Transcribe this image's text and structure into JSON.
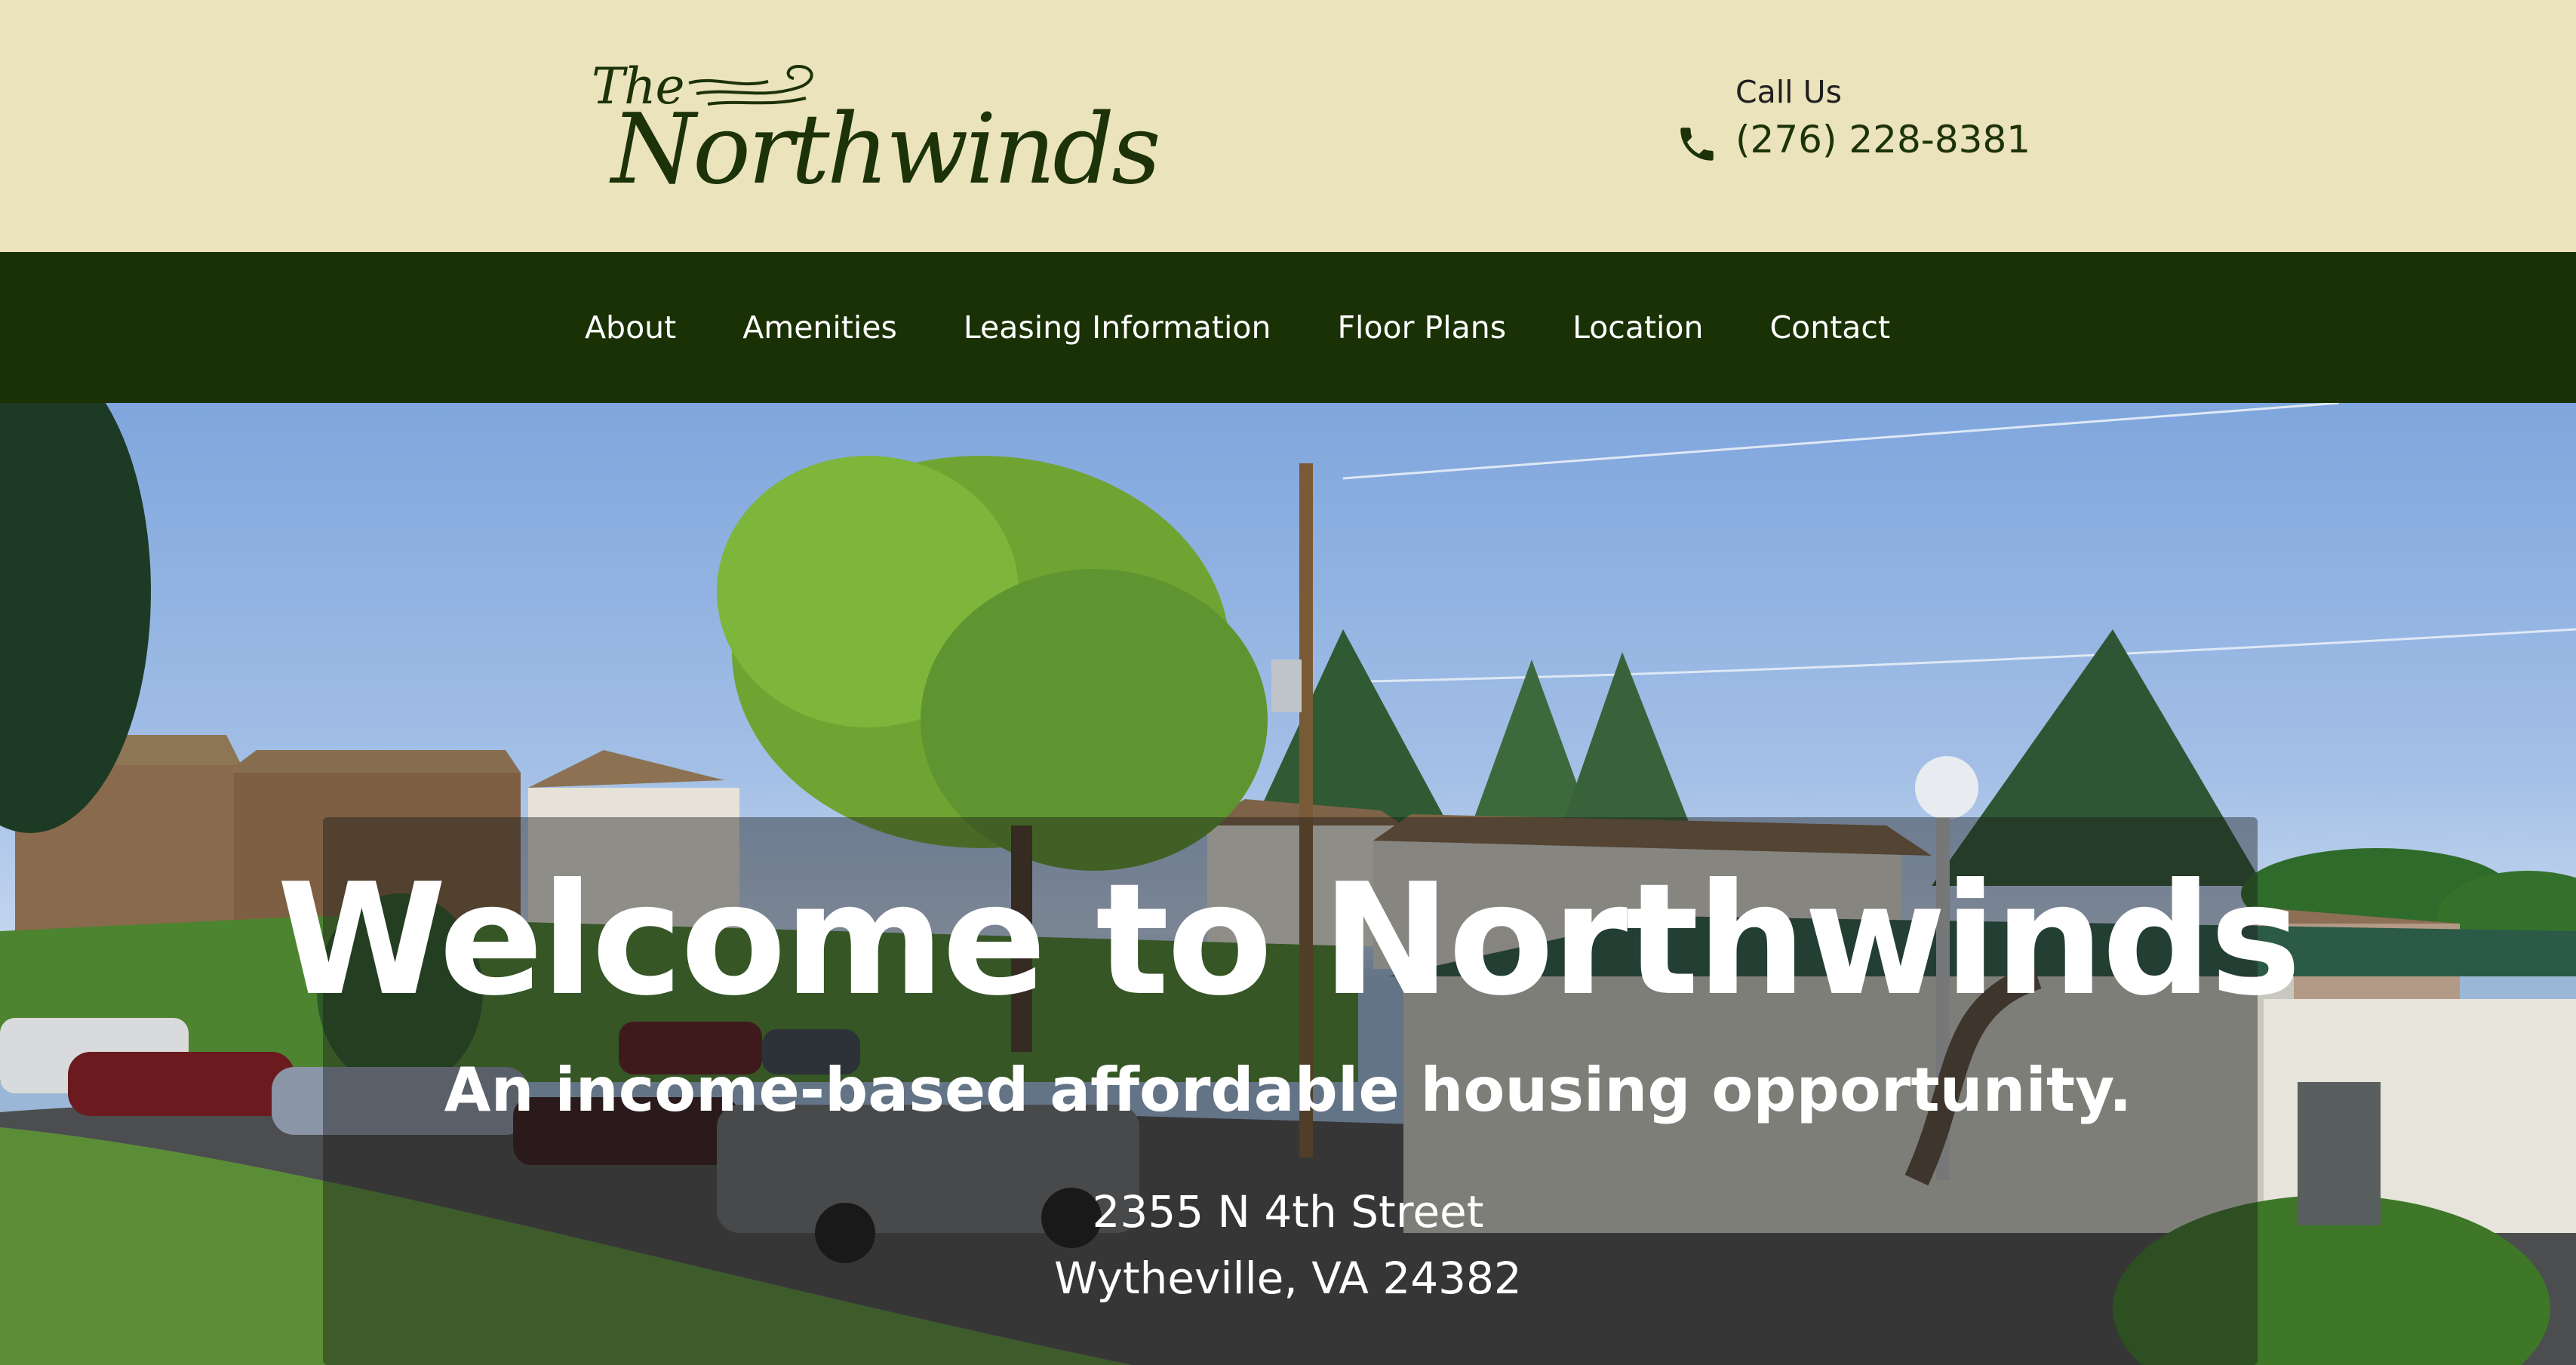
{
  "brand": {
    "logo_the": "The",
    "logo_name": "Northwinds",
    "primary_color": "#1a3005",
    "header_bg": "#ebe3bb"
  },
  "contact": {
    "label": "Call Us",
    "phone": "(276) 228-8381",
    "icon": "phone-icon"
  },
  "nav": {
    "items": [
      {
        "label": "About"
      },
      {
        "label": "Amenities"
      },
      {
        "label": "Leasing Information"
      },
      {
        "label": "Floor Plans"
      },
      {
        "label": "Location"
      },
      {
        "label": "Contact"
      }
    ]
  },
  "hero": {
    "title": "Welcome to Northwinds",
    "subtitle": "An income-based affordable housing opportunity.",
    "address_line1": "2355 N 4th Street",
    "address_line2": "Wytheville, VA 24382"
  }
}
